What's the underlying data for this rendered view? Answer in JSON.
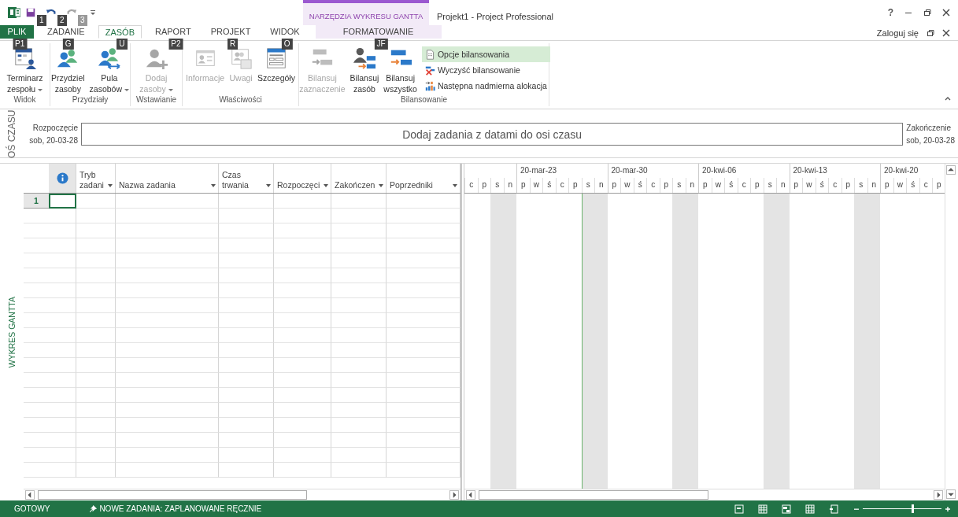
{
  "quick_access": {
    "keytips": [
      "1",
      "2",
      "3"
    ]
  },
  "contextual_group": {
    "label": "NARZĘDZIA WYKRESU GANTTA"
  },
  "window": {
    "title": "Projekt1 - Project Professional",
    "help": "?",
    "sign_in": "Zaloguj się"
  },
  "tabs": [
    {
      "label": "PLIK",
      "keytip": "P1",
      "kind": "file",
      "selected": false
    },
    {
      "label": "ZADANIE",
      "keytip": "G",
      "kind": "normal",
      "selected": false
    },
    {
      "label": "ZASÓB",
      "keytip": "U",
      "kind": "normal",
      "selected": true
    },
    {
      "label": "RAPORT",
      "keytip": "P2",
      "kind": "normal",
      "selected": false
    },
    {
      "label": "PROJEKT",
      "keytip": "R",
      "kind": "normal",
      "selected": false
    },
    {
      "label": "WIDOK",
      "keytip": "O",
      "kind": "normal",
      "selected": false
    },
    {
      "label": "FORMATOWANIE",
      "keytip": "JF",
      "kind": "contextual",
      "selected": false
    }
  ],
  "ribbon": {
    "groups": [
      {
        "label": "Widok",
        "items": [
          {
            "kind": "large",
            "lines": [
              "Terminarz",
              "zespołu"
            ],
            "dropdown": true,
            "disabled": false
          }
        ]
      },
      {
        "label": "Przydziały",
        "items": [
          {
            "kind": "large",
            "lines": [
              "Przydziel",
              "zasoby"
            ],
            "dropdown": false,
            "disabled": false
          },
          {
            "kind": "large",
            "lines": [
              "Pula",
              "zasobów"
            ],
            "dropdown": true,
            "disabled": false
          }
        ]
      },
      {
        "label": "Wstawianie",
        "items": [
          {
            "kind": "large",
            "lines": [
              "Dodaj",
              "zasoby"
            ],
            "dropdown": true,
            "disabled": true
          }
        ]
      },
      {
        "label": "Właściwości",
        "items": [
          {
            "kind": "large",
            "lines": [
              "Informacje"
            ],
            "dropdown": false,
            "disabled": true
          },
          {
            "kind": "large",
            "lines": [
              "Uwagi"
            ],
            "dropdown": false,
            "disabled": true
          },
          {
            "kind": "large",
            "lines": [
              "Szczegóły"
            ],
            "dropdown": false,
            "disabled": false
          }
        ]
      },
      {
        "label": "Bilansowanie",
        "items": [
          {
            "kind": "large",
            "lines": [
              "Bilansuj",
              "zaznaczenie"
            ],
            "dropdown": false,
            "disabled": true
          },
          {
            "kind": "large",
            "lines": [
              "Bilansuj",
              "zasób"
            ],
            "dropdown": false,
            "disabled": false
          },
          {
            "kind": "large",
            "lines": [
              "Bilansuj",
              "wszystko"
            ],
            "dropdown": false,
            "disabled": false
          },
          {
            "kind": "small",
            "lines": [
              "Opcje bilansowania"
            ],
            "disabled": false,
            "hovered": true
          },
          {
            "kind": "small",
            "lines": [
              "Wyczyść bilansowanie"
            ],
            "disabled": false,
            "hovered": false
          },
          {
            "kind": "small",
            "lines": [
              "Następna nadmierna alokacja"
            ],
            "disabled": false,
            "hovered": false
          }
        ]
      }
    ]
  },
  "timeline": {
    "side_label": "OŚ CZASU",
    "start_label": "Rozpoczęcie",
    "start_date": "sob, 20-03-28",
    "placeholder": "Dodaj zadania z datami do osi czasu",
    "end_label": "Zakończenie",
    "end_date": "sob, 20-03-28"
  },
  "view_label": "WYKRES GANTTA",
  "table": {
    "columns": [
      {
        "kind": "info"
      },
      {
        "kind": "text",
        "lines": [
          "Tryb",
          "zadani"
        ]
      },
      {
        "kind": "text",
        "lines": [
          "Nazwa zadania"
        ]
      },
      {
        "kind": "text",
        "lines": [
          "Czas",
          "trwania"
        ]
      },
      {
        "kind": "text",
        "lines": [
          "Rozpoczęci"
        ]
      },
      {
        "kind": "text",
        "lines": [
          "Zakończen"
        ]
      },
      {
        "kind": "text",
        "lines": [
          "Poprzedniki"
        ]
      }
    ],
    "rows": [
      {
        "number": "1",
        "selected": true
      }
    ]
  },
  "gantt": {
    "leading_days": [
      {
        "label": "c",
        "weekend": false,
        "today": false
      },
      {
        "label": "p",
        "weekend": false,
        "today": false
      },
      {
        "label": "s",
        "weekend": true,
        "today": false
      },
      {
        "label": "n",
        "weekend": true,
        "today": false
      }
    ],
    "weeks": [
      {
        "label": "20-mar-23",
        "days": [
          {
            "label": "p",
            "weekend": false,
            "today": false
          },
          {
            "label": "w",
            "weekend": false,
            "today": false
          },
          {
            "label": "ś",
            "weekend": false,
            "today": false
          },
          {
            "label": "c",
            "weekend": false,
            "today": false
          },
          {
            "label": "p",
            "weekend": false,
            "today": false
          },
          {
            "label": "s",
            "weekend": true,
            "today": true
          },
          {
            "label": "n",
            "weekend": true,
            "today": false
          }
        ]
      },
      {
        "label": "20-mar-30",
        "days": [
          {
            "label": "p",
            "weekend": false,
            "today": false
          },
          {
            "label": "w",
            "weekend": false,
            "today": false
          },
          {
            "label": "ś",
            "weekend": false,
            "today": false
          },
          {
            "label": "c",
            "weekend": false,
            "today": false
          },
          {
            "label": "p",
            "weekend": false,
            "today": false
          },
          {
            "label": "s",
            "weekend": true,
            "today": false
          },
          {
            "label": "n",
            "weekend": true,
            "today": false
          }
        ]
      },
      {
        "label": "20-kwi-06",
        "days": [
          {
            "label": "p",
            "weekend": false,
            "today": false
          },
          {
            "label": "w",
            "weekend": false,
            "today": false
          },
          {
            "label": "ś",
            "weekend": false,
            "today": false
          },
          {
            "label": "c",
            "weekend": false,
            "today": false
          },
          {
            "label": "p",
            "weekend": false,
            "today": false
          },
          {
            "label": "s",
            "weekend": true,
            "today": false
          },
          {
            "label": "n",
            "weekend": true,
            "today": false
          }
        ]
      },
      {
        "label": "20-kwi-13",
        "days": [
          {
            "label": "p",
            "weekend": false,
            "today": false
          },
          {
            "label": "w",
            "weekend": false,
            "today": false
          },
          {
            "label": "ś",
            "weekend": false,
            "today": false
          },
          {
            "label": "c",
            "weekend": false,
            "today": false
          },
          {
            "label": "p",
            "weekend": false,
            "today": false
          },
          {
            "label": "s",
            "weekend": true,
            "today": false
          },
          {
            "label": "n",
            "weekend": true,
            "today": false
          }
        ]
      },
      {
        "label": "20-kwi-20",
        "days": [
          {
            "label": "p",
            "weekend": false,
            "today": false
          },
          {
            "label": "w",
            "weekend": false,
            "today": false
          },
          {
            "label": "ś",
            "weekend": false,
            "today": false
          },
          {
            "label": "c",
            "weekend": false,
            "today": false
          },
          {
            "label": "p",
            "weekend": false,
            "today": false
          }
        ]
      }
    ]
  },
  "status_bar": {
    "mode": "GOTOWY",
    "new_tasks": "NOWE ZADANIA: ZAPLANOWANE RĘCZNIE",
    "zoom": {
      "level": 0.62
    }
  }
}
